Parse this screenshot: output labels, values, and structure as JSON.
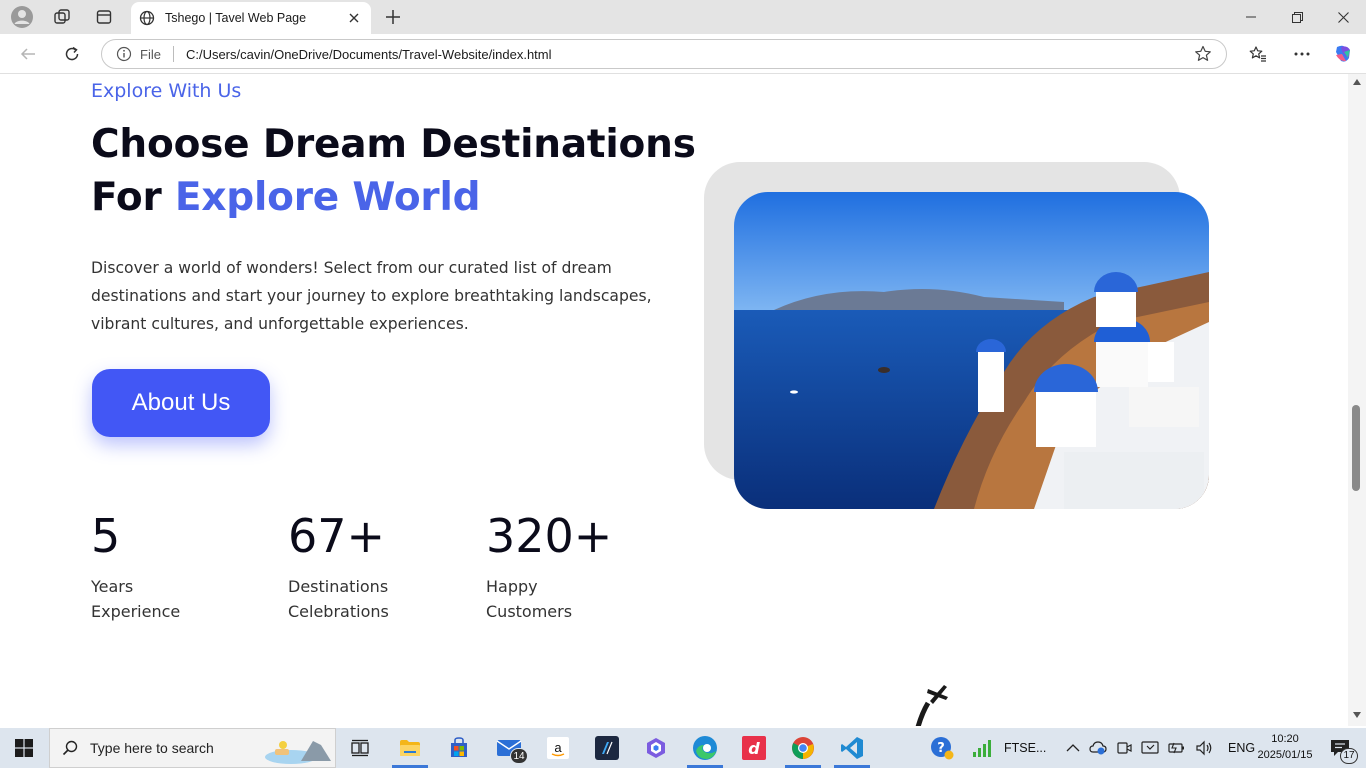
{
  "browser": {
    "tab_title": "Tshego | Tavel Web Page",
    "address_prefix": "File",
    "url": "C:/Users/cavin/OneDrive/Documents/Travel-Website/index.html"
  },
  "hero": {
    "eyebrow": "Explore With Us",
    "headline_line1": "Choose Dream Destinations",
    "headline_line2_plain": "For ",
    "headline_line2_accent": "Explore World",
    "description": "Discover a world of wonders! Select from our curated list of dream destinations and start your journey to explore breathtaking landscapes, vibrant cultures, and unforgettable experiences.",
    "cta_label": "About Us",
    "image_icon": "santorini-photo"
  },
  "stats": [
    {
      "value": "5",
      "label": "Years\nExperience"
    },
    {
      "value": "67+",
      "label": "Destinations\nCelebrations"
    },
    {
      "value": "320+",
      "label": "Happy\nCustomers"
    }
  ],
  "taskbar": {
    "search_placeholder": "Type here to search",
    "mail_badge": "14",
    "stock_ticker": "FTSE...",
    "language": "ENG",
    "time": "10:20",
    "date": "2025/01/15",
    "notification_count": "17"
  },
  "colors": {
    "accent": "#4a64e8",
    "button": "#4257f5",
    "heading": "#0b0b1a"
  }
}
